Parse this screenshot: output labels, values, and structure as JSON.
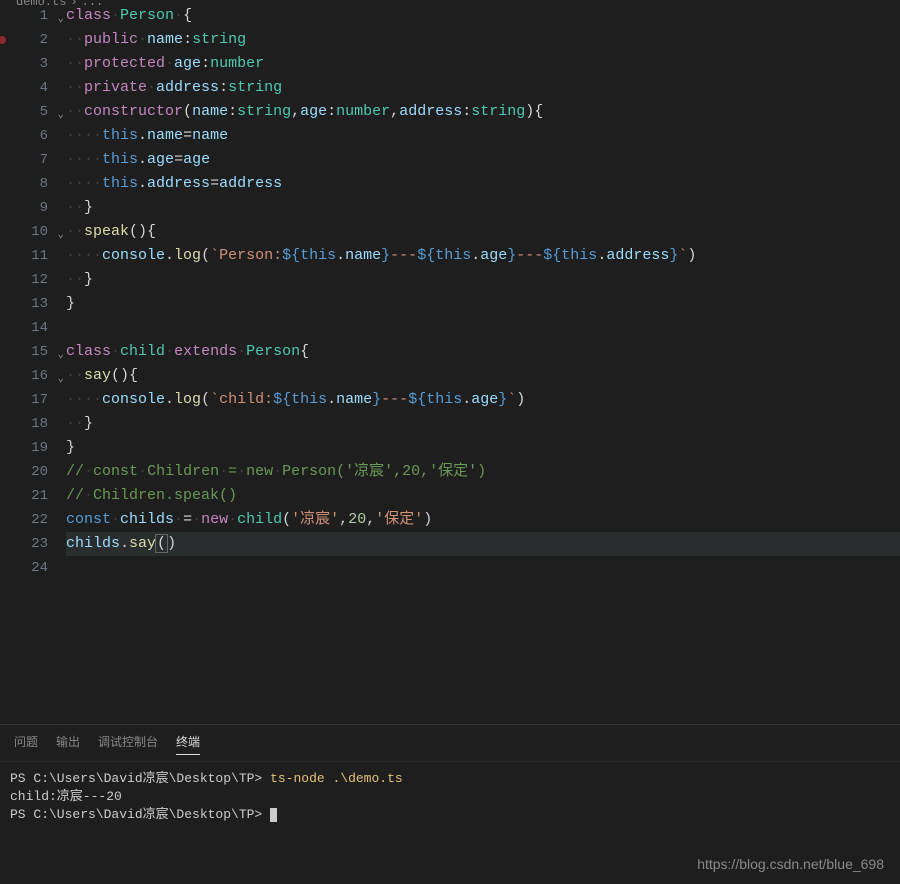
{
  "breadcrumb": {
    "file": "demo.ts",
    "symbol": "..."
  },
  "lines": [
    {
      "n": 1,
      "fold": true,
      "html": "<span class='kw'>class</span><span class='ws'>·</span><span class='cls'>Person</span><span class='ws'>·</span><span class='pun'>{</span>"
    },
    {
      "n": 2,
      "bp": true,
      "html": "<span class='ws'>··</span><span class='mod'>public</span><span class='ws'>·</span><span class='prop'>name</span><span class='pun'>:</span><span class='typ'>string</span>"
    },
    {
      "n": 3,
      "html": "<span class='ws'>··</span><span class='mod'>protected</span><span class='ws'>·</span><span class='prop'>age</span><span class='pun'>:</span><span class='typ'>number</span>"
    },
    {
      "n": 4,
      "html": "<span class='ws'>··</span><span class='mod'>private</span><span class='ws'>·</span><span class='prop'>address</span><span class='pun'>:</span><span class='typ'>string</span>"
    },
    {
      "n": 5,
      "fold": true,
      "html": "<span class='ws'>··</span><span class='kw'>constructor</span><span class='pun'>(</span><span class='var'>name</span><span class='pun'>:</span><span class='typ'>string</span><span class='pun'>,</span><span class='var'>age</span><span class='pun'>:</span><span class='typ'>number</span><span class='pun'>,</span><span class='var'>address</span><span class='pun'>:</span><span class='typ'>string</span><span class='pun'>){</span>"
    },
    {
      "n": 6,
      "html": "<span class='ws'>····</span><span class='tmpl'>this</span><span class='pun'>.</span><span class='prop'>name</span><span class='pun'>=</span><span class='var'>name</span>"
    },
    {
      "n": 7,
      "html": "<span class='ws'>····</span><span class='tmpl'>this</span><span class='pun'>.</span><span class='prop'>age</span><span class='pun'>=</span><span class='var'>age</span>"
    },
    {
      "n": 8,
      "html": "<span class='ws'>····</span><span class='tmpl'>this</span><span class='pun'>.</span><span class='prop'>address</span><span class='pun'>=</span><span class='var'>address</span>"
    },
    {
      "n": 9,
      "html": "<span class='ws'>··</span><span class='pun'>}</span>"
    },
    {
      "n": 10,
      "fold": true,
      "html": "<span class='ws'>··</span><span class='fn'>speak</span><span class='pun'>(){</span>"
    },
    {
      "n": 11,
      "html": "<span class='ws'>····</span><span class='var'>console</span><span class='pun'>.</span><span class='fn'>log</span><span class='pun'>(</span><span class='str'>`Person:</span><span class='tmpl'>${</span><span class='tmpl'>this</span><span class='pun'>.</span><span class='prop'>name</span><span class='tmpl'>}</span><span class='str'>---</span><span class='tmpl'>${</span><span class='tmpl'>this</span><span class='pun'>.</span><span class='prop'>age</span><span class='tmpl'>}</span><span class='str'>---</span><span class='tmpl'>${</span><span class='tmpl'>this</span><span class='pun'>.</span><span class='prop'>address</span><span class='tmpl'>}</span><span class='str'>`</span><span class='pun'>)</span>"
    },
    {
      "n": 12,
      "html": "<span class='ws'>··</span><span class='pun'>}</span>"
    },
    {
      "n": 13,
      "html": "<span class='pun'>}</span>"
    },
    {
      "n": 14,
      "html": ""
    },
    {
      "n": 15,
      "fold": true,
      "html": "<span class='kw'>class</span><span class='ws'>·</span><span class='cls'>child</span><span class='ws'>·</span><span class='kw'>extends</span><span class='ws'>·</span><span class='cls'>Person</span><span class='pun'>{</span>"
    },
    {
      "n": 16,
      "fold": true,
      "html": "<span class='ws'>··</span><span class='fn'>say</span><span class='pun'>(){</span>"
    },
    {
      "n": 17,
      "html": "<span class='ws'>····</span><span class='var'>console</span><span class='pun'>.</span><span class='fn'>log</span><span class='pun'>(</span><span class='str'>`child:</span><span class='tmpl'>${</span><span class='tmpl'>this</span><span class='pun'>.</span><span class='prop'>name</span><span class='tmpl'>}</span><span class='str'>---</span><span class='tmpl'>${</span><span class='tmpl'>this</span><span class='pun'>.</span><span class='prop'>age</span><span class='tmpl'>}</span><span class='str'>`</span><span class='pun'>)</span>"
    },
    {
      "n": 18,
      "html": "<span class='ws'>··</span><span class='pun'>}</span>"
    },
    {
      "n": 19,
      "html": "<span class='pun'>}</span>"
    },
    {
      "n": 20,
      "html": "<span class='cmt'>//<span class='ws'>·</span>const<span class='ws'>·</span>Children<span class='ws'>·</span>=<span class='ws'>·</span>new<span class='ws'>·</span>Person('凉宸',20,'保定')</span>"
    },
    {
      "n": 21,
      "html": "<span class='cmt'>//<span class='ws'>·</span>Children.speak()</span>"
    },
    {
      "n": 22,
      "html": "<span class='tmpl'>const</span><span class='ws'>·</span><span class='var'>childs</span><span class='ws'>·</span><span class='pun'>=</span><span class='ws'>·</span><span class='kw'>new</span><span class='ws'>·</span><span class='cls'>child</span><span class='pun'>(</span><span class='str'>'凉宸'</span><span class='pun'>,</span><span class='num'>20</span><span class='pun'>,</span><span class='str'>'保定'</span><span class='pun'>)</span>"
    },
    {
      "n": 23,
      "hl": true,
      "html": "<span class='var'>childs</span><span class='pun'>.</span><span class='fn'>say</span><span class='bracket-box'><span class='pun'>(</span></span><span class='pun'>)</span>"
    },
    {
      "n": 24,
      "html": ""
    }
  ],
  "panel": {
    "tabs": {
      "problems": "问题",
      "output": "输出",
      "debug": "调试控制台",
      "terminal": "终端"
    },
    "terminal": {
      "line1_prompt": "PS C:\\Users\\David凉宸\\Desktop\\TP>",
      "line1_cmd": "ts-node .\\demo.ts",
      "line2": "child:凉宸---20",
      "line3_prompt": "PS C:\\Users\\David凉宸\\Desktop\\TP>"
    }
  },
  "watermark": "https://blog.csdn.net/blue_698"
}
